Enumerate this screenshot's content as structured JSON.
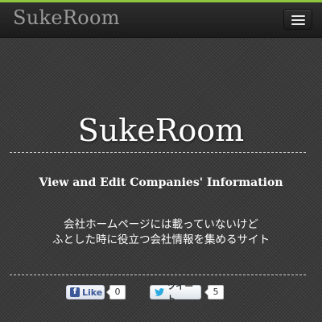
{
  "navbar": {
    "brand": "SukeRoom",
    "menu_icon": "hamburger-menu-icon"
  },
  "hero": {
    "title": "SukeRoom",
    "tagline": "View and Edit Companies' Information",
    "description_line1": "会社ホームページには載っていないけど",
    "description_line2": "ふとした時に役立つ会社情報を集めるサイト"
  },
  "social": {
    "facebook": {
      "icon": "facebook-icon",
      "label": "Like",
      "count": "0"
    },
    "twitter": {
      "icon": "twitter-bird-icon",
      "label": "ツイート",
      "count": "5"
    }
  },
  "colors": {
    "accent": "#8ec63f",
    "background": "#3a3a3a",
    "navbar": "#222222",
    "brand_text": "#9a9a9a"
  }
}
